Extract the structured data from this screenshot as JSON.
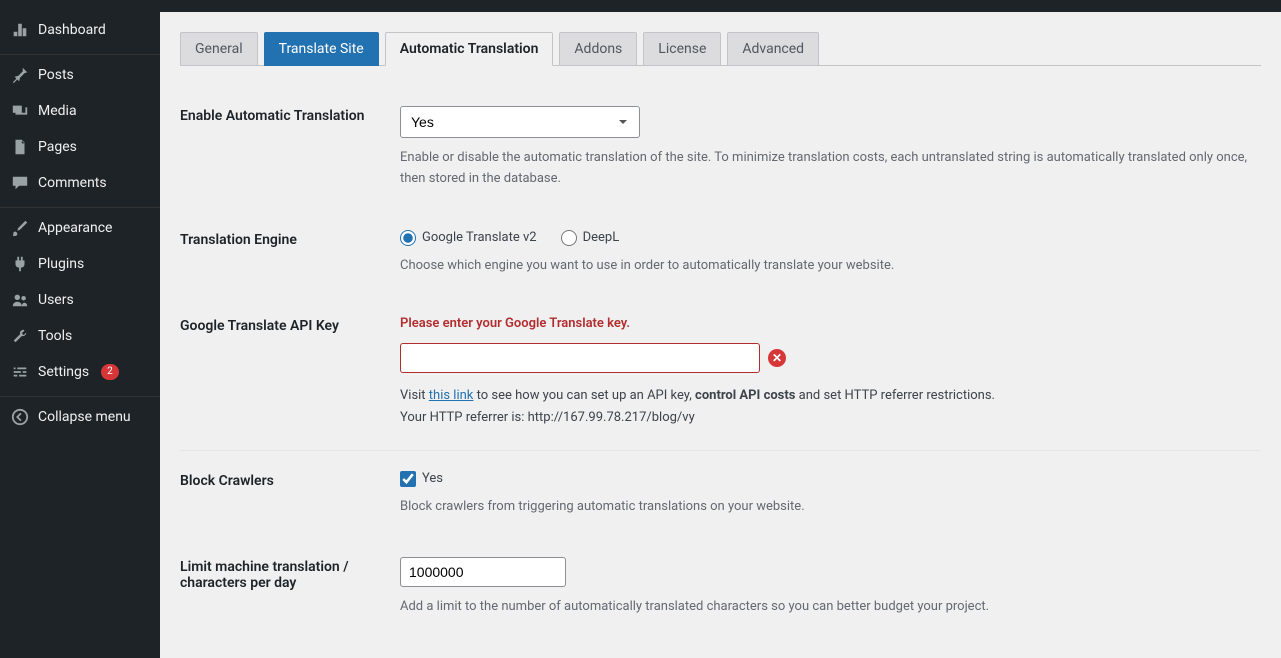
{
  "sidebar": {
    "items": [
      {
        "label": "Dashboard"
      },
      {
        "label": "Posts"
      },
      {
        "label": "Media"
      },
      {
        "label": "Pages"
      },
      {
        "label": "Comments"
      },
      {
        "label": "Appearance"
      },
      {
        "label": "Plugins"
      },
      {
        "label": "Users"
      },
      {
        "label": "Tools"
      },
      {
        "label": "Settings",
        "badge": "2"
      },
      {
        "label": "Collapse menu"
      }
    ]
  },
  "tabs": [
    {
      "label": "General"
    },
    {
      "label": "Translate Site"
    },
    {
      "label": "Automatic Translation"
    },
    {
      "label": "Addons"
    },
    {
      "label": "License"
    },
    {
      "label": "Advanced"
    }
  ],
  "form": {
    "enable": {
      "label": "Enable Automatic Translation",
      "value": "Yes",
      "desc": "Enable or disable the automatic translation of the site. To minimize translation costs, each untranslated string is automatically translated only once, then stored in the database."
    },
    "engine": {
      "label": "Translation Engine",
      "options": {
        "google": "Google Translate v2",
        "deepl": "DeepL"
      },
      "desc": "Choose which engine you want to use in order to automatically translate your website."
    },
    "apikey": {
      "label": "Google Translate API Key",
      "warning": "Please enter your Google Translate key.",
      "value": "",
      "help_prefix": "Visit ",
      "link_text": "this link",
      "help_mid": " to see how you can set up an API key, ",
      "help_bold": "control API costs",
      "help_suffix": " and set HTTP referrer restrictions.",
      "referrer_line": "Your HTTP referrer is: http://167.99.78.217/blog/vy"
    },
    "block": {
      "label": "Block Crawlers",
      "chk_label": "Yes",
      "desc": "Block crawlers from triggering automatic translations on your website."
    },
    "limit": {
      "label": "Limit machine translation / characters per day",
      "value": "1000000",
      "desc": "Add a limit to the number of automatically translated characters so you can better budget your project."
    }
  }
}
